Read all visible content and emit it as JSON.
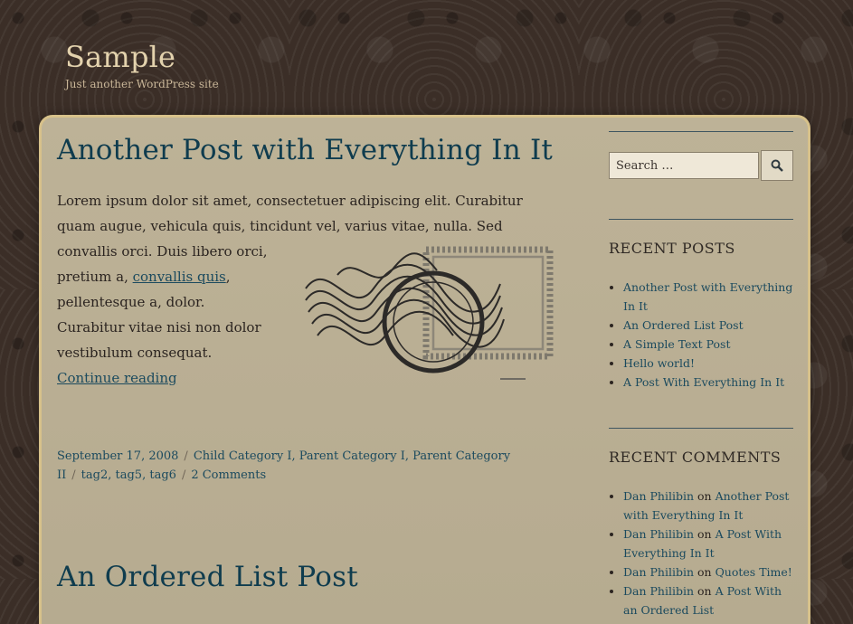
{
  "site": {
    "title": "Sample",
    "description": "Just another WordPress site"
  },
  "posts": [
    {
      "title": "Another Post with Everything In It",
      "body_line1": "Lorem ipsum dolor sit amet, consectetuer adipiscing elit. Curabitur quam augue, vehicula quis, tincidunt vel, varius vitae, nulla. Sed convallis orci. Duis libero orci,",
      "body_line2_pre": "pretium a, ",
      "body_link": "convallis quis",
      "body_line2_post": ",",
      "body_rest": "pellentesque a, dolor. Curabitur vitae nisi non dolor vestibulum consequat.",
      "continue": "Continue reading",
      "date": "September 17, 2008",
      "categories": [
        "Child Category I",
        "Parent Category I",
        "Parent Category II"
      ],
      "tags": [
        "tag2",
        "tag5",
        "tag6"
      ],
      "comments": "2 Comments"
    },
    {
      "title": "An Ordered List Post"
    }
  ],
  "search": {
    "placeholder": "Search …"
  },
  "recent_posts": {
    "title": "RECENT POSTS",
    "items": [
      "Another Post with Everything In It",
      "An Ordered List Post",
      "A Simple Text Post",
      "Hello world!",
      "A Post With Everything In It"
    ]
  },
  "recent_comments": {
    "title": "RECENT COMMENTS",
    "connector": "on",
    "items": [
      {
        "author": "Dan Philibin",
        "post": "Another Post with Everything In It"
      },
      {
        "author": "Dan Philibin",
        "post": "A Post With Everything In It"
      },
      {
        "author": "Dan Philibin",
        "post": "Quotes Time!"
      },
      {
        "author": "Dan Philibin",
        "post": "A Post With an Ordered List"
      }
    ]
  },
  "icons": {
    "search": "search-icon",
    "stamp": "postage-stamp-image"
  },
  "colors": {
    "link": "#1b4a5e",
    "title": "#0f3c4e",
    "panel": "#b8ad93",
    "background": "#3b2e27",
    "site_title": "#e3d2ad"
  }
}
